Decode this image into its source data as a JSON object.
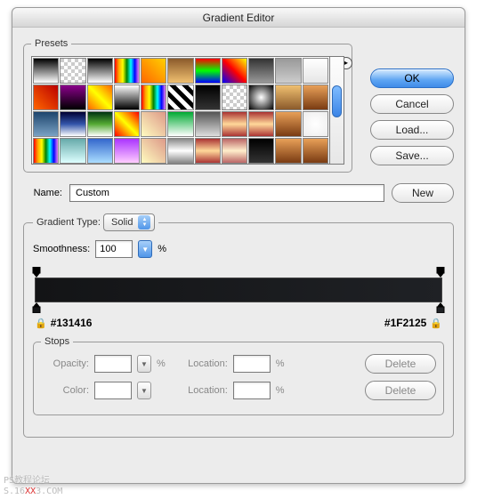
{
  "title": "Gradient Editor",
  "presets_label": "Presets",
  "buttons": {
    "ok": "OK",
    "cancel": "Cancel",
    "load": "Load...",
    "save": "Save...",
    "new": "New",
    "delete": "Delete"
  },
  "labels": {
    "name": "Name:",
    "gradient_type": "Gradient Type:",
    "smoothness": "Smoothness:",
    "percent": "%",
    "stops": "Stops",
    "opacity": "Opacity:",
    "color": "Color:",
    "location": "Location:"
  },
  "name_value": "Custom",
  "gradient_type_value": "Solid",
  "smoothness_value": "100",
  "gradient": {
    "left_hex": "#131416",
    "right_hex": "#1F2125"
  },
  "stops_fields": {
    "opacity_value": "",
    "opacity_location": "",
    "color_value": "",
    "color_location": ""
  },
  "swatches": [
    "linear-gradient(#000,#fff)",
    "repeating-conic-gradient(#fff 0 25%,#ccc 0 50%) 0 0/8px 8px",
    "linear-gradient(#000,#fff)",
    "linear-gradient(90deg,red,orange,yellow,green,cyan,blue,violet)",
    "linear-gradient(45deg,#f60,#ffd000)",
    "linear-gradient(#8b5a2b,#f0c070)",
    "linear-gradient(#f00,#0f0,#00f)",
    "linear-gradient(45deg,#0000ff,#ff0000,#ffff00)",
    "linear-gradient(#333,#999)",
    "linear-gradient(#999,#ccc)",
    "linear-gradient(#fff,#e6e6e6)",
    "linear-gradient(45deg,#f60,#b00)",
    "linear-gradient(#8b008b,#000)",
    "linear-gradient(45deg,#f60,#ff0,#f60)",
    "linear-gradient(#fff,#000)",
    "linear-gradient(90deg,red,orange,yellow,green,cyan,blue,violet)",
    "repeating-linear-gradient(45deg,#000 0 5px,#fff 5px 10px)",
    "linear-gradient(#000,#333)",
    "repeating-conic-gradient(#fff 0 25%,#ccc 0 50%) 0 0/8px 8px",
    "radial-gradient(#fff,#000)",
    "linear-gradient(#f0c070,#8b5a2b)",
    "linear-gradient(#e8a058,#7a3b12)",
    "linear-gradient(#1e456d,#7aa2c4)",
    "linear-gradient(#003,#35a,#fff)",
    "linear-gradient(#031,#5a3,#fff)",
    "linear-gradient(45deg,#f00,#ff0,#f00)",
    "linear-gradient(45deg,#fffcc0,#d98)",
    "linear-gradient(#0a3,#fff)",
    "linear-gradient(#555,#ddd)",
    "linear-gradient(#a33,#ffd89a,#a33)",
    "linear-gradient(#a33,#ffd89a,#a33)",
    "linear-gradient(#e8a058,#7a3b12)",
    "radial-gradient(#fff,#eee)",
    "linear-gradient(90deg,red,orange,yellow,green,cyan,blue,violet)",
    "linear-gradient(#6aa,#dff)",
    "linear-gradient(#36c,#adf)",
    "linear-gradient(#a3f,#fcf)",
    "linear-gradient(45deg,#fffcc0,#d98)",
    "linear-gradient(#888,#fff,#888)",
    "linear-gradient(#a33,#ffd89a,#a33)",
    "linear-gradient(#b66,#fec,#b66)",
    "linear-gradient(#000,#333)",
    "linear-gradient(#e8a058,#7a3b12)",
    "linear-gradient(#e8a058,#7a3b12)"
  ],
  "watermark": {
    "line1": "PS教程论坛",
    "line2_a": "S.16",
    "line2_xx": "XX",
    "line2_b": "3.COM"
  }
}
